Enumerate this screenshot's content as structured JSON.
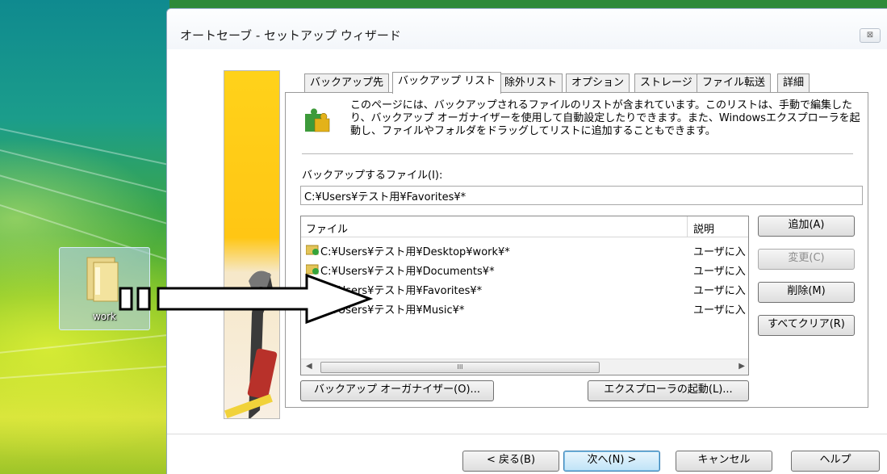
{
  "desktop": {
    "icon_label": "work"
  },
  "window": {
    "title": "オートセーブ - セットアップ ウィザード",
    "close_glyph": "⊠"
  },
  "tabs": [
    {
      "label": "バックアップ先",
      "active": false
    },
    {
      "label": "バックアップ リスト",
      "active": true
    },
    {
      "label": "除外リスト",
      "active": false
    },
    {
      "label": "オプション",
      "active": false
    },
    {
      "label": "ストレージ",
      "active": false
    },
    {
      "label": "ファイル転送",
      "active": false
    },
    {
      "label": "詳細",
      "active": false
    }
  ],
  "panel": {
    "description": "このページには、バックアップされるファイルのリストが含まれています。このリストは、手動で編集したり、バックアップ オーガナイザーを使用して自動設定したりできます。また、Windowsエクスプローラを起動し、ファイルやフォルダをドラッグしてリストに追加することもできます。",
    "files_label": "バックアップするファイル(I):",
    "files_value": "C:¥Users¥テスト用¥Favorites¥*",
    "list": {
      "columns": [
        "ファイル",
        "説明"
      ],
      "rows": [
        {
          "path": "C:¥Users¥テスト用¥Desktop¥work¥*",
          "desc": "ユーザに入"
        },
        {
          "path": "C:¥Users¥テスト用¥Documents¥*",
          "desc": "ユーザに入"
        },
        {
          "path": "C:¥Users¥テスト用¥Favorites¥*",
          "desc": "ユーザに入"
        },
        {
          "path": "C:¥Users¥テスト用¥Music¥*",
          "desc": "ユーザに入"
        }
      ],
      "scroll_thumb_glyph": "III"
    },
    "buttons": {
      "add": "追加(A)",
      "change": "変更(C)",
      "delete": "削除(M)",
      "clear_all": "すべてクリア(R)",
      "organizer": "バックアップ オーガナイザー(O)...",
      "explorer": "エクスプローラの起動(L)..."
    }
  },
  "footer": {
    "back": "< 戻る(B)",
    "next": "次へ(N) >",
    "cancel": "キャンセル",
    "help": "ヘルプ"
  }
}
